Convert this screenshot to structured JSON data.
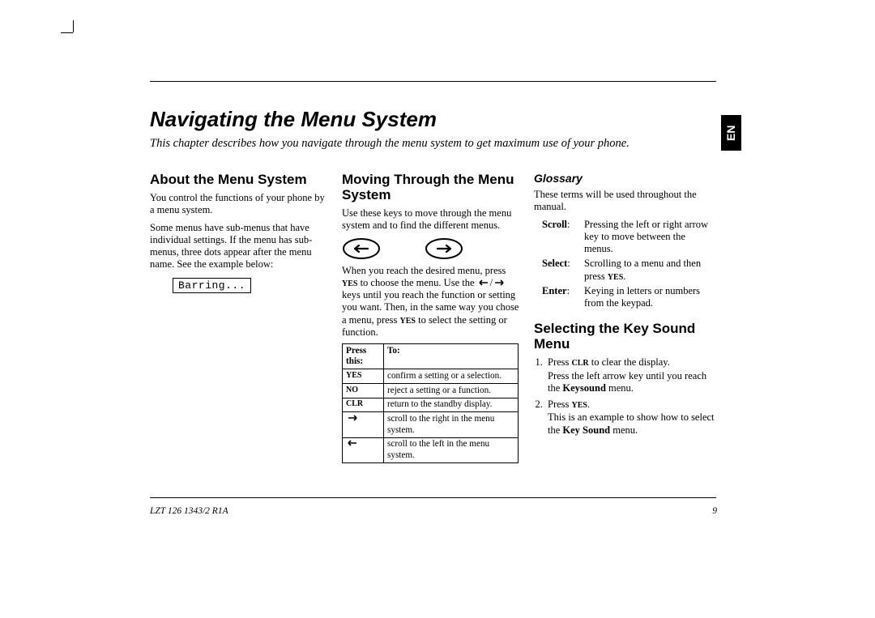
{
  "lang_tab": "EN",
  "title": "Navigating the Menu System",
  "intro": "This chapter describes how you navigate through the menu system to get maximum use of your phone.",
  "col1": {
    "heading": "About the Menu System",
    "p1": "You control the functions of your phone by a menu system.",
    "p2": "Some menus have sub-menus that have individual settings. If the menu has sub-menus, three dots appear after the menu name. See the example below:",
    "display": "Barring..."
  },
  "col2": {
    "heading": "Moving Through the Menu System",
    "p1": "Use these keys to move through the menu system and to find the different menus.",
    "p2a": "When you reach the desired menu, press ",
    "p2yes": "YES",
    "p2b": " to choose the menu. Use the ",
    "p2c": " keys until you reach the function or setting you want. Then, in the same way you chose a menu, press ",
    "p2d": " to select the setting or function.",
    "table": {
      "h1": "Press this:",
      "h2": "To:",
      "rows": [
        {
          "k": "YES",
          "v": "confirm a setting or a selection."
        },
        {
          "k": "NO",
          "v": "reject a setting or a function."
        },
        {
          "k": "CLR",
          "v": "return to the standby display."
        },
        {
          "k": "ICON_R",
          "v": "scroll to the right in the menu system."
        },
        {
          "k": "ICON_L",
          "v": "scroll to the left in the menu system."
        }
      ]
    }
  },
  "col3": {
    "glossary_heading": "Glossary",
    "glossary_intro": "These terms will be used throughout the manual.",
    "glossary": [
      {
        "term": "Scroll",
        "def": "Pressing the left or right arrow key to move between the menus."
      },
      {
        "term": "Select",
        "def_a": "Scrolling to a menu and then press ",
        "def_key": "YES",
        "def_b": "."
      },
      {
        "term": "Enter",
        "def": "Keying in letters or numbers from the keypad."
      }
    ],
    "select_heading": "Selecting the Key Sound Menu",
    "step1a": "Press ",
    "step1clr": "CLR",
    "step1b": " to clear the display.",
    "step1sub_a": "Press the left arrow key until you reach the ",
    "step1sub_b": "Keysound",
    "step1sub_c": " menu.",
    "step2a": "Press ",
    "step2yes": "YES",
    "step2b": ".",
    "step2sub_a": "This is an example to show how to select the ",
    "step2sub_b": "Key Sound",
    "step2sub_c": " menu."
  },
  "footer_left": "LZT 126 1343/2 R1A",
  "footer_right": "9"
}
